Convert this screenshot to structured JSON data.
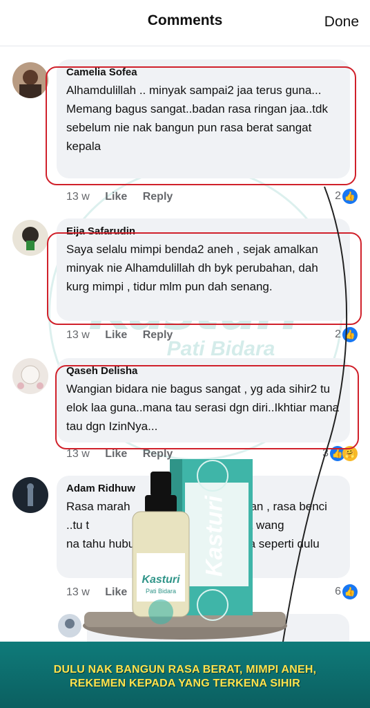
{
  "header": {
    "title": "Comments",
    "done_label": "Done"
  },
  "watermark": {
    "brand": "Kasturi",
    "sub": "Pati Bidara"
  },
  "comments": [
    {
      "name": "Camelia Sofea",
      "text": "Alhamdulillah .. minyak sampai2 jaa terus guna...\nMemang bagus sangat..badan rasa ringan jaa..tdk sebelum nie nak bangun pun rasa berat sangat kepala",
      "time": "13 w",
      "like": "Like",
      "reply": "Reply",
      "reactions": "2"
    },
    {
      "name": "Eija Safarudin",
      "text": "Saya selalu mimpi benda2 aneh , sejak amalkan minyak nie Alhamdulillah dh byk perubahan, dah kurg mimpi , tidur mlm pun dah senang.",
      "time": "13 w",
      "like": "Like",
      "reply": "Reply",
      "reactions": "2"
    },
    {
      "name": "Qaseh Delisha",
      "text": "Wangian bidara nie bagus sangat , yg ada sihir2 tu elok laa guna..mana tau serasi dgn diri..Ikhtiar mana tau dgn IzinNya...",
      "time": "13 w",
      "like": "Like",
      "reply": "Reply",
      "reactions": "3"
    },
    {
      "name": "Adam Ridhuw",
      "text": "Rasa marah                         pasangan , rasa benci ..tu t                        ke.. ingt nk cuba wang                          na tahu hubungan                           a seperti dulu",
      "time": "13 w",
      "like": "Like",
      "reply": "Reply",
      "reactions": "6"
    }
  ],
  "product": {
    "brand": "Kasturi",
    "sub": "Pati Bidara"
  },
  "banner": {
    "line1": "DULU NAK BANGUN RASA BERAT, MIMPI ANEH,",
    "line2": "REKEMEN KEPADA YANG TERKENA SIHIR"
  },
  "colors": {
    "accent": "#1877f2",
    "annotation": "#d0202a",
    "banner": "#0f7b7a",
    "banner_text": "#ffe34d"
  }
}
